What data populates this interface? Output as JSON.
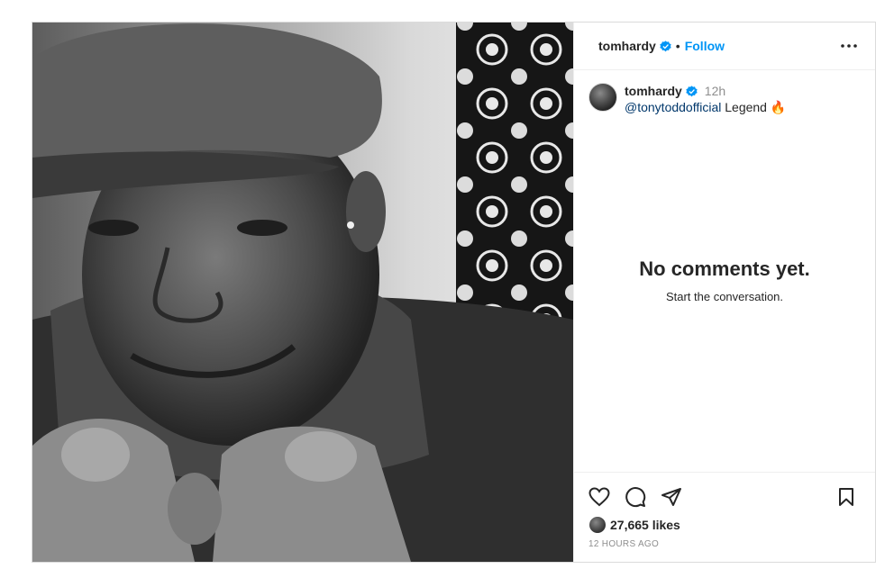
{
  "header": {
    "username": "tomhardy",
    "separator": "•",
    "follow_label": "Follow"
  },
  "caption": {
    "username": "tomhardy",
    "time": "12h",
    "mention": "@tonytoddofficial",
    "text": " Legend 🔥"
  },
  "comments": {
    "empty_title": "No comments yet.",
    "empty_subtitle": "Start the conversation."
  },
  "engagement": {
    "likes": "27,665 likes",
    "posted": "12 HOURS AGO"
  },
  "colors": {
    "accent": "#0095f6",
    "verified": "#0095f6",
    "border": "#dbdbdb"
  },
  "icons": [
    "verified-badge-icon",
    "more-options-icon",
    "heart-icon",
    "comment-icon",
    "share-icon",
    "bookmark-icon"
  ]
}
